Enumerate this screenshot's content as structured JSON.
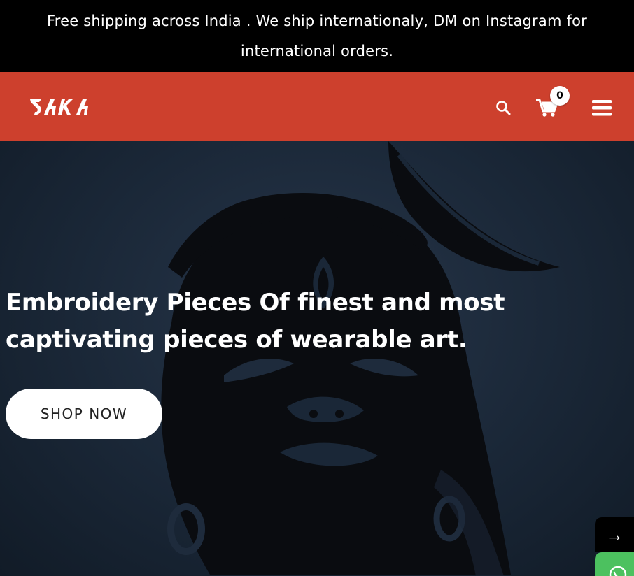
{
  "announcement": {
    "text": "Free shipping across India . We ship internationaly, DM on Instagram for international orders."
  },
  "header": {
    "logo_text": "BAKA",
    "cart_count": "0",
    "colors": {
      "header_bg": "#cd402d",
      "announcement_bg": "#000000"
    },
    "icons": [
      "search-icon",
      "cart-icon",
      "hamburger-menu-icon"
    ]
  },
  "hero": {
    "heading": "Embroidery Pieces Of finest and most captivating pieces of wearable art.",
    "cta_label": "SHOP NOW",
    "next_label": "→"
  },
  "floating": {
    "icons": [
      "arrow-right-icon",
      "whatsapp-icon"
    ]
  }
}
